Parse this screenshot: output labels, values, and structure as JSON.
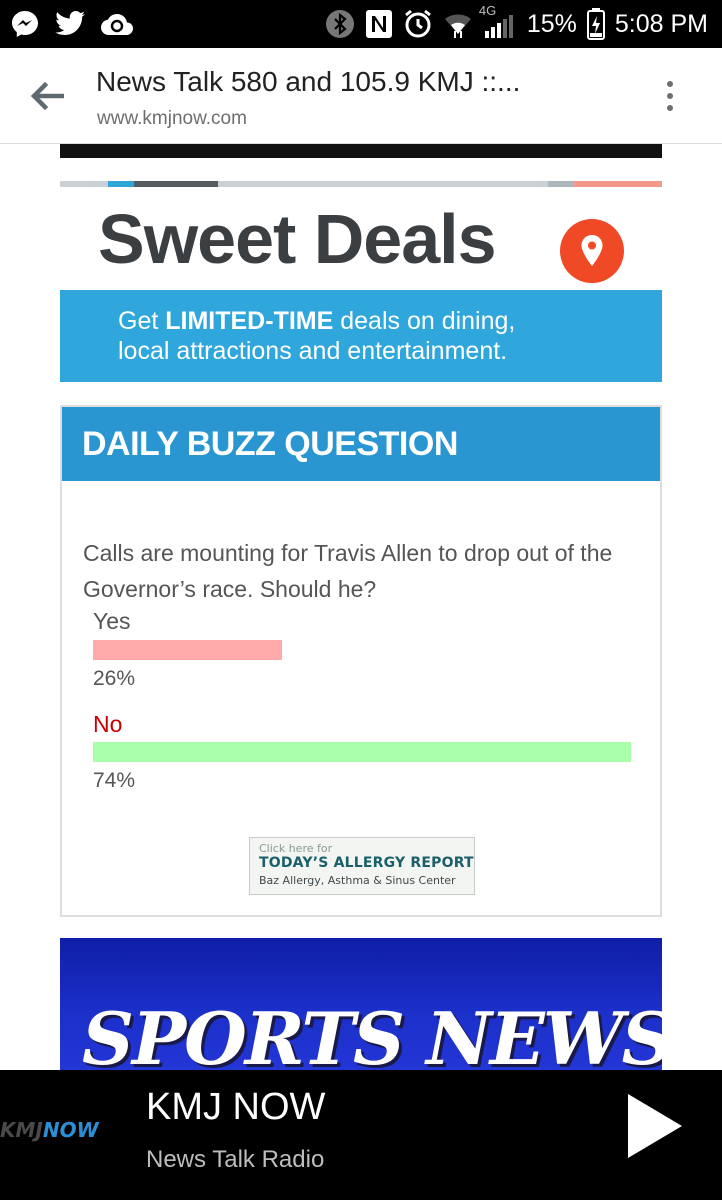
{
  "status_bar": {
    "battery": "15%",
    "time": "5:08 PM",
    "network": "4G",
    "icons": [
      "messenger-icon",
      "twitter-icon",
      "cloud-icon",
      "bluetooth-icon",
      "nfc-icon",
      "alarm-icon",
      "wifi-icon",
      "signal-icon",
      "battery-icon"
    ]
  },
  "browser": {
    "title": "News Talk 580 and 105.9 KMJ ::...",
    "url": "www.kmjnow.com"
  },
  "sweet_deals": {
    "title": "Sweet Deals",
    "banner_prefix": "Get",
    "banner_bold": "LIMITED-TIME",
    "banner_suffix": "deals on dining,",
    "banner_line2": "local attractions and entertainment."
  },
  "daily_buzz": {
    "header": "DAILY BUZZ QUESTION",
    "question": "Calls are mounting for Travis Allen to drop out of the Governor’s race. Should he?",
    "options": [
      {
        "label": "Yes",
        "percent_text": "26%",
        "value": 26,
        "color": "#ffaaaa"
      },
      {
        "label": "No",
        "percent_text": "74%",
        "value": 74,
        "color": "#aaffaa"
      }
    ]
  },
  "allergy_ad": {
    "line1": "Click here for",
    "line2": "TODAY’S ALLERGY REPORT",
    "line3": "Baz Allergy, Asthma & Sinus Center"
  },
  "sports_banner": {
    "text": "SPORTS NEWS"
  },
  "player": {
    "logo_k": "KMJ",
    "logo_now": "NOW",
    "title": "KMJ NOW",
    "subtitle": "News Talk Radio"
  }
}
